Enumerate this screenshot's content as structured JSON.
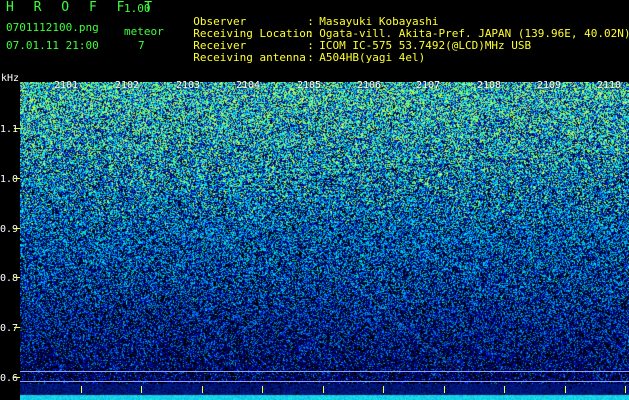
{
  "header": {
    "app_name": "H R O F F T",
    "version": "1.00",
    "filename": "0701112100.png",
    "datetime": "07.01.11 21:00",
    "meteor_label": "meteor",
    "meteor_count": "7"
  },
  "info": [
    {
      "label": "Observer",
      "value": "Masayuki Kobayashi"
    },
    {
      "label": "Receiving Location",
      "value": "Ogata-vill. Akita-Pref. JAPAN (139.96E, 40.02N)"
    },
    {
      "label": "Receiver",
      "value": "ICOM IC-575 53.7492(@LCD)MHz USB"
    },
    {
      "label": "Receiving antenna",
      "value": "A504HB(yagi 4el)"
    }
  ],
  "info_separator": ":",
  "axis": {
    "y_unit": "kHz",
    "y_ticks": [
      "1.1",
      "1.0",
      "0.9",
      "0.8",
      "0.7",
      "0.6"
    ],
    "x_ticks": [
      "2101",
      "2102",
      "2103",
      "2104",
      "2105",
      "2106",
      "2107",
      "2108",
      "2109",
      "2110"
    ]
  },
  "colors": {
    "header_green": "#3dff3d",
    "header_yellow": "#ffff30",
    "tick_yellow": "#ffff30",
    "background": "#000000"
  }
}
